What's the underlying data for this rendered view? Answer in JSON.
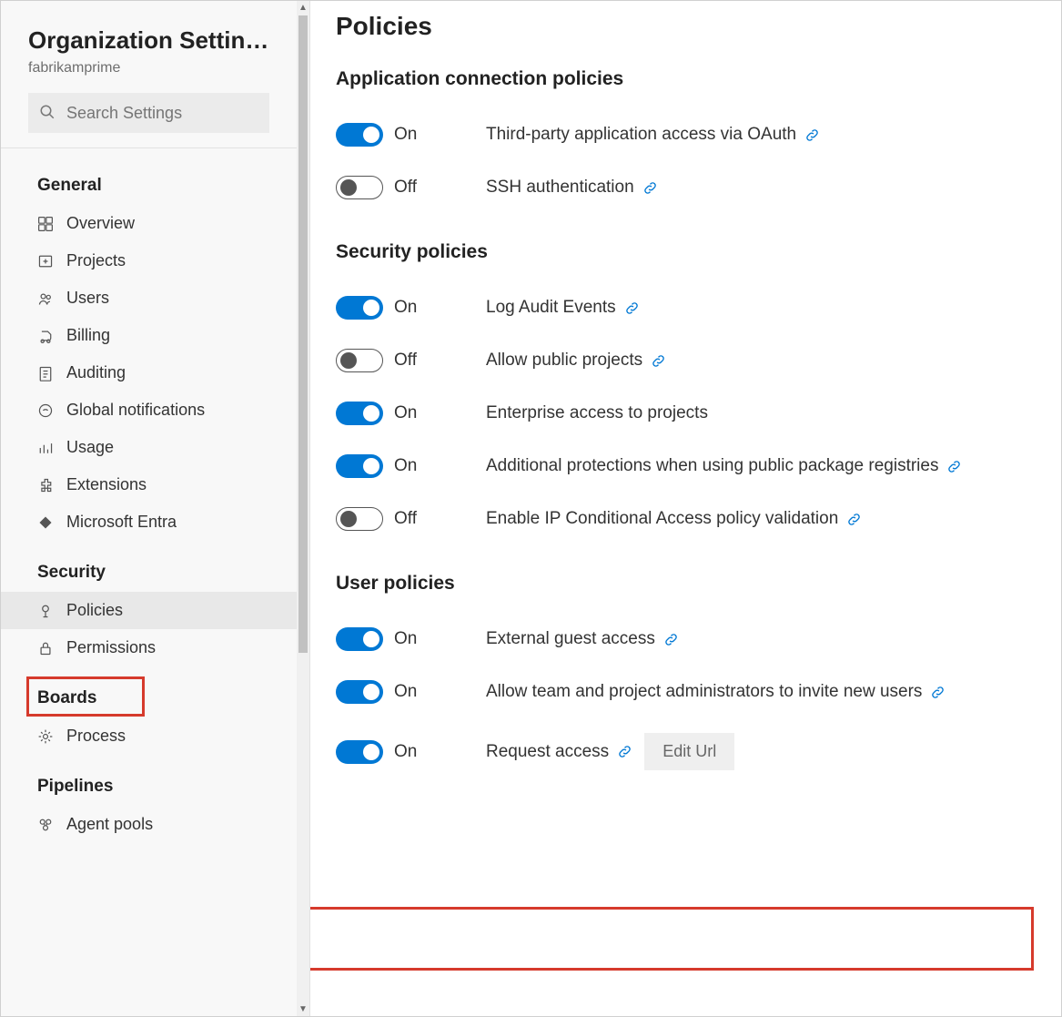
{
  "sidebar": {
    "title": "Organization Settin…",
    "subtitle": "fabrikamprime",
    "search_placeholder": "Search Settings",
    "groups": [
      {
        "title": "General",
        "items": [
          {
            "icon": "overview",
            "label": "Overview"
          },
          {
            "icon": "projects",
            "label": "Projects"
          },
          {
            "icon": "users",
            "label": "Users"
          },
          {
            "icon": "billing",
            "label": "Billing"
          },
          {
            "icon": "auditing",
            "label": "Auditing"
          },
          {
            "icon": "notifications",
            "label": "Global notifications"
          },
          {
            "icon": "usage",
            "label": "Usage"
          },
          {
            "icon": "extensions",
            "label": "Extensions"
          },
          {
            "icon": "entra",
            "label": "Microsoft Entra"
          }
        ]
      },
      {
        "title": "Security",
        "items": [
          {
            "icon": "policies",
            "label": "Policies",
            "active": true
          },
          {
            "icon": "permissions",
            "label": "Permissions"
          }
        ]
      },
      {
        "title": "Boards",
        "items": [
          {
            "icon": "process",
            "label": "Process"
          }
        ]
      },
      {
        "title": "Pipelines",
        "items": [
          {
            "icon": "agentpools",
            "label": "Agent pools"
          }
        ]
      }
    ]
  },
  "main": {
    "page_title": "Policies",
    "state_labels": {
      "on": "On",
      "off": "Off"
    },
    "edit_url_label": "Edit Url",
    "sections": [
      {
        "title": "Application connection policies",
        "policies": [
          {
            "on": true,
            "label": "Third-party application access via OAuth",
            "link": true
          },
          {
            "on": false,
            "label": "SSH authentication",
            "link": true
          }
        ]
      },
      {
        "title": "Security policies",
        "policies": [
          {
            "on": true,
            "label": "Log Audit Events",
            "link": true
          },
          {
            "on": false,
            "label": "Allow public projects",
            "link": true
          },
          {
            "on": true,
            "label": "Enterprise access to projects",
            "link": false
          },
          {
            "on": true,
            "label": "Additional protections when using public package registries",
            "link": true
          },
          {
            "on": false,
            "label": "Enable IP Conditional Access policy validation",
            "link": true
          }
        ]
      },
      {
        "title": "User policies",
        "policies": [
          {
            "on": true,
            "label": "External guest access",
            "link": true
          },
          {
            "on": true,
            "label": "Allow team and project administrators to invite new users",
            "link": true
          },
          {
            "on": true,
            "label": "Request access",
            "link": true,
            "edit_url": true
          }
        ]
      }
    ]
  }
}
